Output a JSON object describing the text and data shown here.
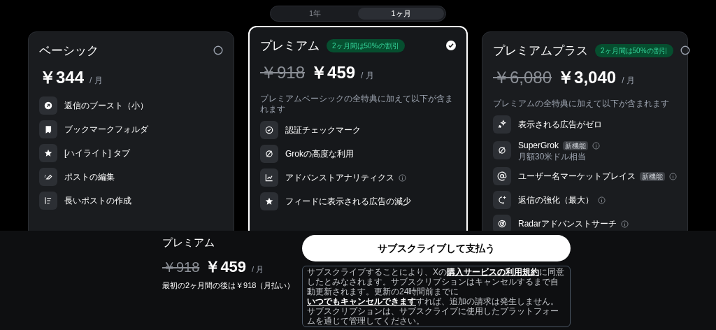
{
  "billing_tabs": [
    {
      "label": "1年",
      "selected": false
    },
    {
      "label": "1ヶ月",
      "selected": true
    }
  ],
  "plans": [
    {
      "name": "ベーシック",
      "selected": false,
      "price": "￥344",
      "per": "/ 月",
      "features": [
        {
          "label": "返信のブースト（小）"
        },
        {
          "label": "ブックマークフォルダ"
        },
        {
          "label": "[ハイライト] タブ"
        },
        {
          "label": "ポストの編集"
        },
        {
          "label": "長いポストの作成"
        }
      ]
    },
    {
      "name": "プレミアム",
      "selected": true,
      "discount": "2ヶ月間は50%の割引",
      "old_price": "￥918",
      "price": "￥459",
      "per": "/ 月",
      "description": "プレミアムベーシックの全特典に加えて以下が含まれます",
      "features": [
        {
          "label": "認証チェックマーク"
        },
        {
          "label": "Grokの高度な利用"
        },
        {
          "label": "アドバンストアナリティクス",
          "info": true
        },
        {
          "label": "フィードに表示される広告の減少"
        }
      ]
    },
    {
      "name": "プレミアムプラス",
      "selected": false,
      "discount": "2ヶ月間は50%の割引",
      "old_price": "￥6,080",
      "price": "￥3,040",
      "per": "/ 月",
      "description": "プレミアムの全特典に加えて以下が含まれます",
      "features": [
        {
          "label": "表示される広告がゼロ"
        },
        {
          "label": "SuperGrok",
          "badge": "新機能",
          "info": true,
          "sub": "月額30米ドル相当"
        },
        {
          "label": "ユーザー名マーケットプレイス",
          "badge": "新機能",
          "info": true
        },
        {
          "label": "返信の強化（最大）",
          "info": true
        },
        {
          "label": "Radarアドバンストサーチ",
          "info": true
        }
      ]
    }
  ],
  "summary": {
    "plan": "プレミアム",
    "old_price": "￥918",
    "price": "￥459",
    "per": "/ 月",
    "note": "最初の2ヶ月間の後は￥918（月払い）"
  },
  "subscribe_button": "サブスクライブして支払う",
  "legal": [
    {
      "text": "サブスクライブすることにより、Xの",
      "link": false
    },
    {
      "text": "購入サービスの利用規約",
      "link": true
    },
    {
      "text": "に同意したとみなされます。サブスクリプションはキャンセルするまで自動更新されます。更新の24時間前までに",
      "link": false
    },
    {
      "text": "いつでもキャンセルできます",
      "link": true
    },
    {
      "text": "すれば、追加の請求は発生しません。サブスクリプションは、サブスクライブに使用したプラットフォームを通じて管理してください。",
      "link": false
    }
  ]
}
